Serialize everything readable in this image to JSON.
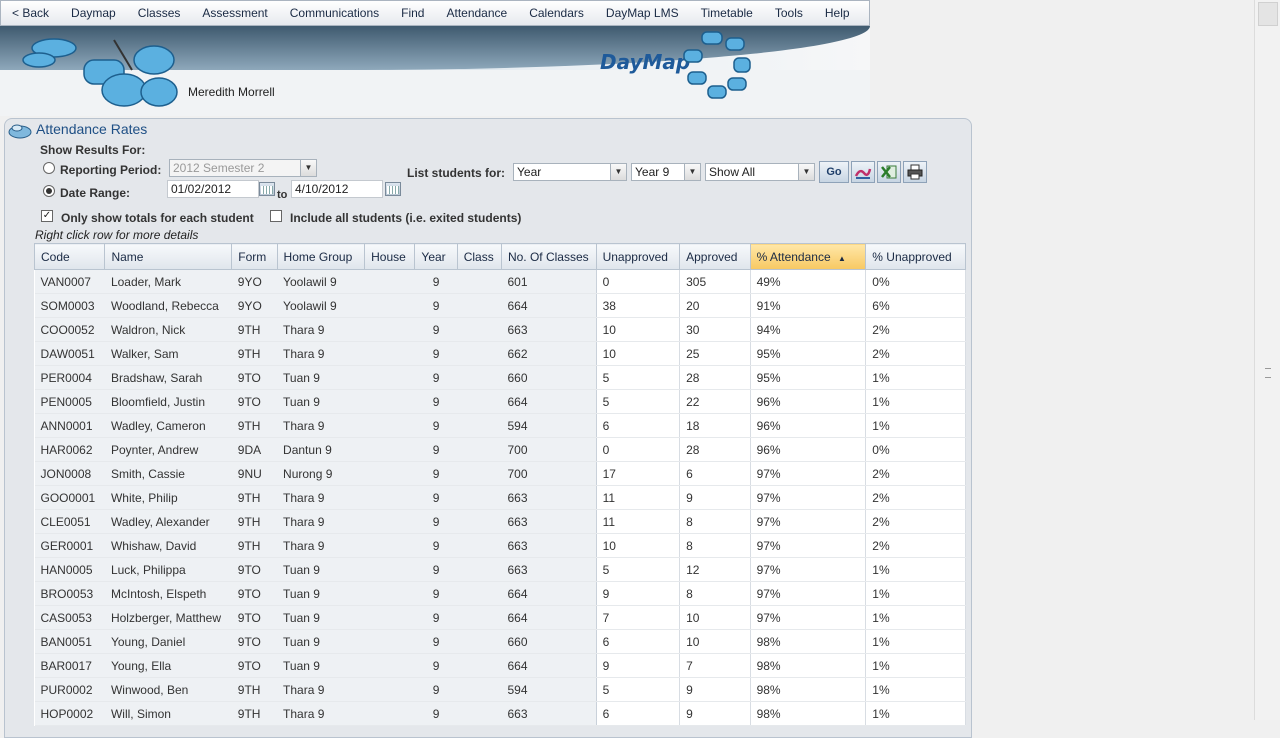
{
  "menu": {
    "back": "< Back",
    "items": [
      "Daymap",
      "Classes",
      "Assessment",
      "Communications",
      "Find",
      "Attendance",
      "Calendars",
      "DayMap LMS",
      "Timetable",
      "Tools",
      "Help"
    ]
  },
  "header": {
    "brand": "DayMap",
    "user_name": "Meredith Morrell"
  },
  "panel": {
    "title": "Attendance Rates",
    "show_results_for": "Show Results For:",
    "reporting_period_label": "Reporting Period:",
    "reporting_period_value": "2012 Semester 2",
    "date_range_label": "Date Range:",
    "date_from": "01/02/2012",
    "date_to_label": "to",
    "date_to": "4/10/2012",
    "list_students_for_label": "List students for:",
    "list_type": "Year",
    "year_value": "Year 9",
    "show_value": "Show All",
    "go_label": "Go",
    "only_totals_label": "Only show totals for each student",
    "include_all_label": "Include all students (i.e. exited students)",
    "hint": "Right click row for more details"
  },
  "table": {
    "columns": [
      "Code",
      "Name",
      "Form",
      "Home Group",
      "House",
      "Year",
      "Class",
      "No. Of Classes",
      "Unapproved",
      "Approved",
      "% Attendance",
      "% Unapproved"
    ],
    "sort_indicator": "▲",
    "rows": [
      [
        "VAN0007",
        "Loader, Mark",
        "9YO",
        "Yoolawil 9",
        "",
        "9",
        "",
        "601",
        "0",
        "305",
        "49%",
        "0%"
      ],
      [
        "SOM0003",
        "Woodland, Rebecca",
        "9YO",
        "Yoolawil 9",
        "",
        "9",
        "",
        "664",
        "38",
        "20",
        "91%",
        "6%"
      ],
      [
        "COO0052",
        "Waldron, Nick",
        "9TH",
        "Thara 9",
        "",
        "9",
        "",
        "663",
        "10",
        "30",
        "94%",
        "2%"
      ],
      [
        "DAW0051",
        "Walker, Sam",
        "9TH",
        "Thara 9",
        "",
        "9",
        "",
        "662",
        "10",
        "25",
        "95%",
        "2%"
      ],
      [
        "PER0004",
        "Bradshaw, Sarah",
        "9TO",
        "Tuan 9",
        "",
        "9",
        "",
        "660",
        "5",
        "28",
        "95%",
        "1%"
      ],
      [
        "PEN0005",
        "Bloomfield, Justin",
        "9TO",
        "Tuan 9",
        "",
        "9",
        "",
        "664",
        "5",
        "22",
        "96%",
        "1%"
      ],
      [
        "ANN0001",
        "Wadley, Cameron",
        "9TH",
        "Thara 9",
        "",
        "9",
        "",
        "594",
        "6",
        "18",
        "96%",
        "1%"
      ],
      [
        "HAR0062",
        "Poynter, Andrew",
        "9DA",
        "Dantun 9",
        "",
        "9",
        "",
        "700",
        "0",
        "28",
        "96%",
        "0%"
      ],
      [
        "JON0008",
        "Smith, Cassie",
        "9NU",
        "Nurong 9",
        "",
        "9",
        "",
        "700",
        "17",
        "6",
        "97%",
        "2%"
      ],
      [
        "GOO0001",
        "White, Philip",
        "9TH",
        "Thara 9",
        "",
        "9",
        "",
        "663",
        "11",
        "9",
        "97%",
        "2%"
      ],
      [
        "CLE0051",
        "Wadley, Alexander",
        "9TH",
        "Thara 9",
        "",
        "9",
        "",
        "663",
        "11",
        "8",
        "97%",
        "2%"
      ],
      [
        "GER0001",
        "Whishaw, David",
        "9TH",
        "Thara 9",
        "",
        "9",
        "",
        "663",
        "10",
        "8",
        "97%",
        "2%"
      ],
      [
        "HAN0005",
        "Luck, Philippa",
        "9TO",
        "Tuan 9",
        "",
        "9",
        "",
        "663",
        "5",
        "12",
        "97%",
        "1%"
      ],
      [
        "BRO0053",
        "McIntosh, Elspeth",
        "9TO",
        "Tuan 9",
        "",
        "9",
        "",
        "664",
        "9",
        "8",
        "97%",
        "1%"
      ],
      [
        "CAS0053",
        "Holzberger, Matthew",
        "9TO",
        "Tuan 9",
        "",
        "9",
        "",
        "664",
        "7",
        "10",
        "97%",
        "1%"
      ],
      [
        "BAN0051",
        "Young, Daniel",
        "9TO",
        "Tuan 9",
        "",
        "9",
        "",
        "660",
        "6",
        "10",
        "98%",
        "1%"
      ],
      [
        "BAR0017",
        "Young, Ella",
        "9TO",
        "Tuan 9",
        "",
        "9",
        "",
        "664",
        "9",
        "7",
        "98%",
        "1%"
      ],
      [
        "PUR0002",
        "Winwood, Ben",
        "9TH",
        "Thara 9",
        "",
        "9",
        "",
        "594",
        "5",
        "9",
        "98%",
        "1%"
      ],
      [
        "HOP0002",
        "Will, Simon",
        "9TH",
        "Thara 9",
        "",
        "9",
        "",
        "663",
        "6",
        "9",
        "98%",
        "1%"
      ]
    ]
  },
  "colors": {
    "accent": "#1e4f85",
    "sorted_header": "#f7c862",
    "panel_bg": "#e4e7eb"
  }
}
